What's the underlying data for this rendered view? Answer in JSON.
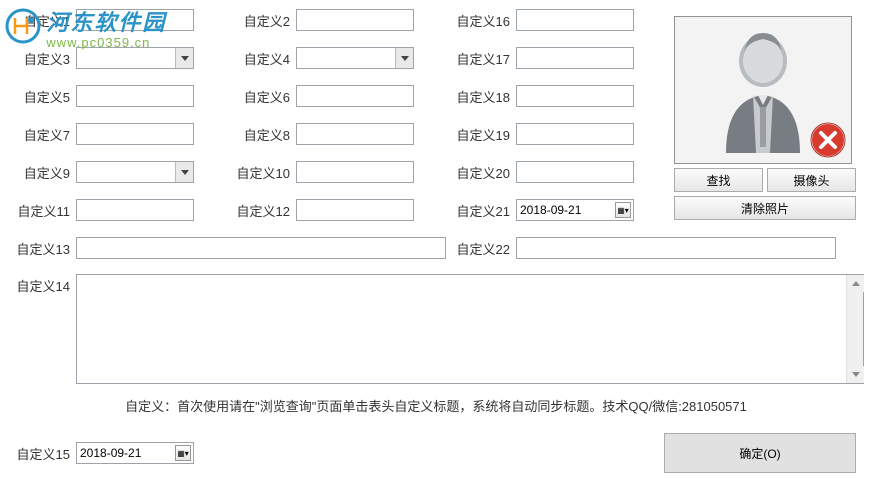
{
  "watermark": {
    "title": "河东软件园",
    "url": "www.pc0359.cn"
  },
  "labels": {
    "f1": "自定义1",
    "f2": "自定义2",
    "f3": "自定义3",
    "f4": "自定义4",
    "f5": "自定义5",
    "f6": "自定义6",
    "f7": "自定义7",
    "f8": "自定义8",
    "f9": "自定义9",
    "f10": "自定义10",
    "f11": "自定义11",
    "f12": "自定义12",
    "f13": "自定义13",
    "f14": "自定义14",
    "f15": "自定义15",
    "f16": "自定义16",
    "f17": "自定义17",
    "f18": "自定义18",
    "f19": "自定义19",
    "f20": "自定义20",
    "f21": "自定义21",
    "f22": "自定义22"
  },
  "values": {
    "f21": "2018-09-21",
    "f15": "2018-09-21"
  },
  "photo": {
    "find": "查找",
    "camera": "摄像头",
    "clear": "清除照片"
  },
  "hint": "自定义：首次使用请在\"浏览查询\"页面单击表头自定义标题，系统将自动同步标题。技术QQ/微信:281050571",
  "ok": "确定(O)"
}
